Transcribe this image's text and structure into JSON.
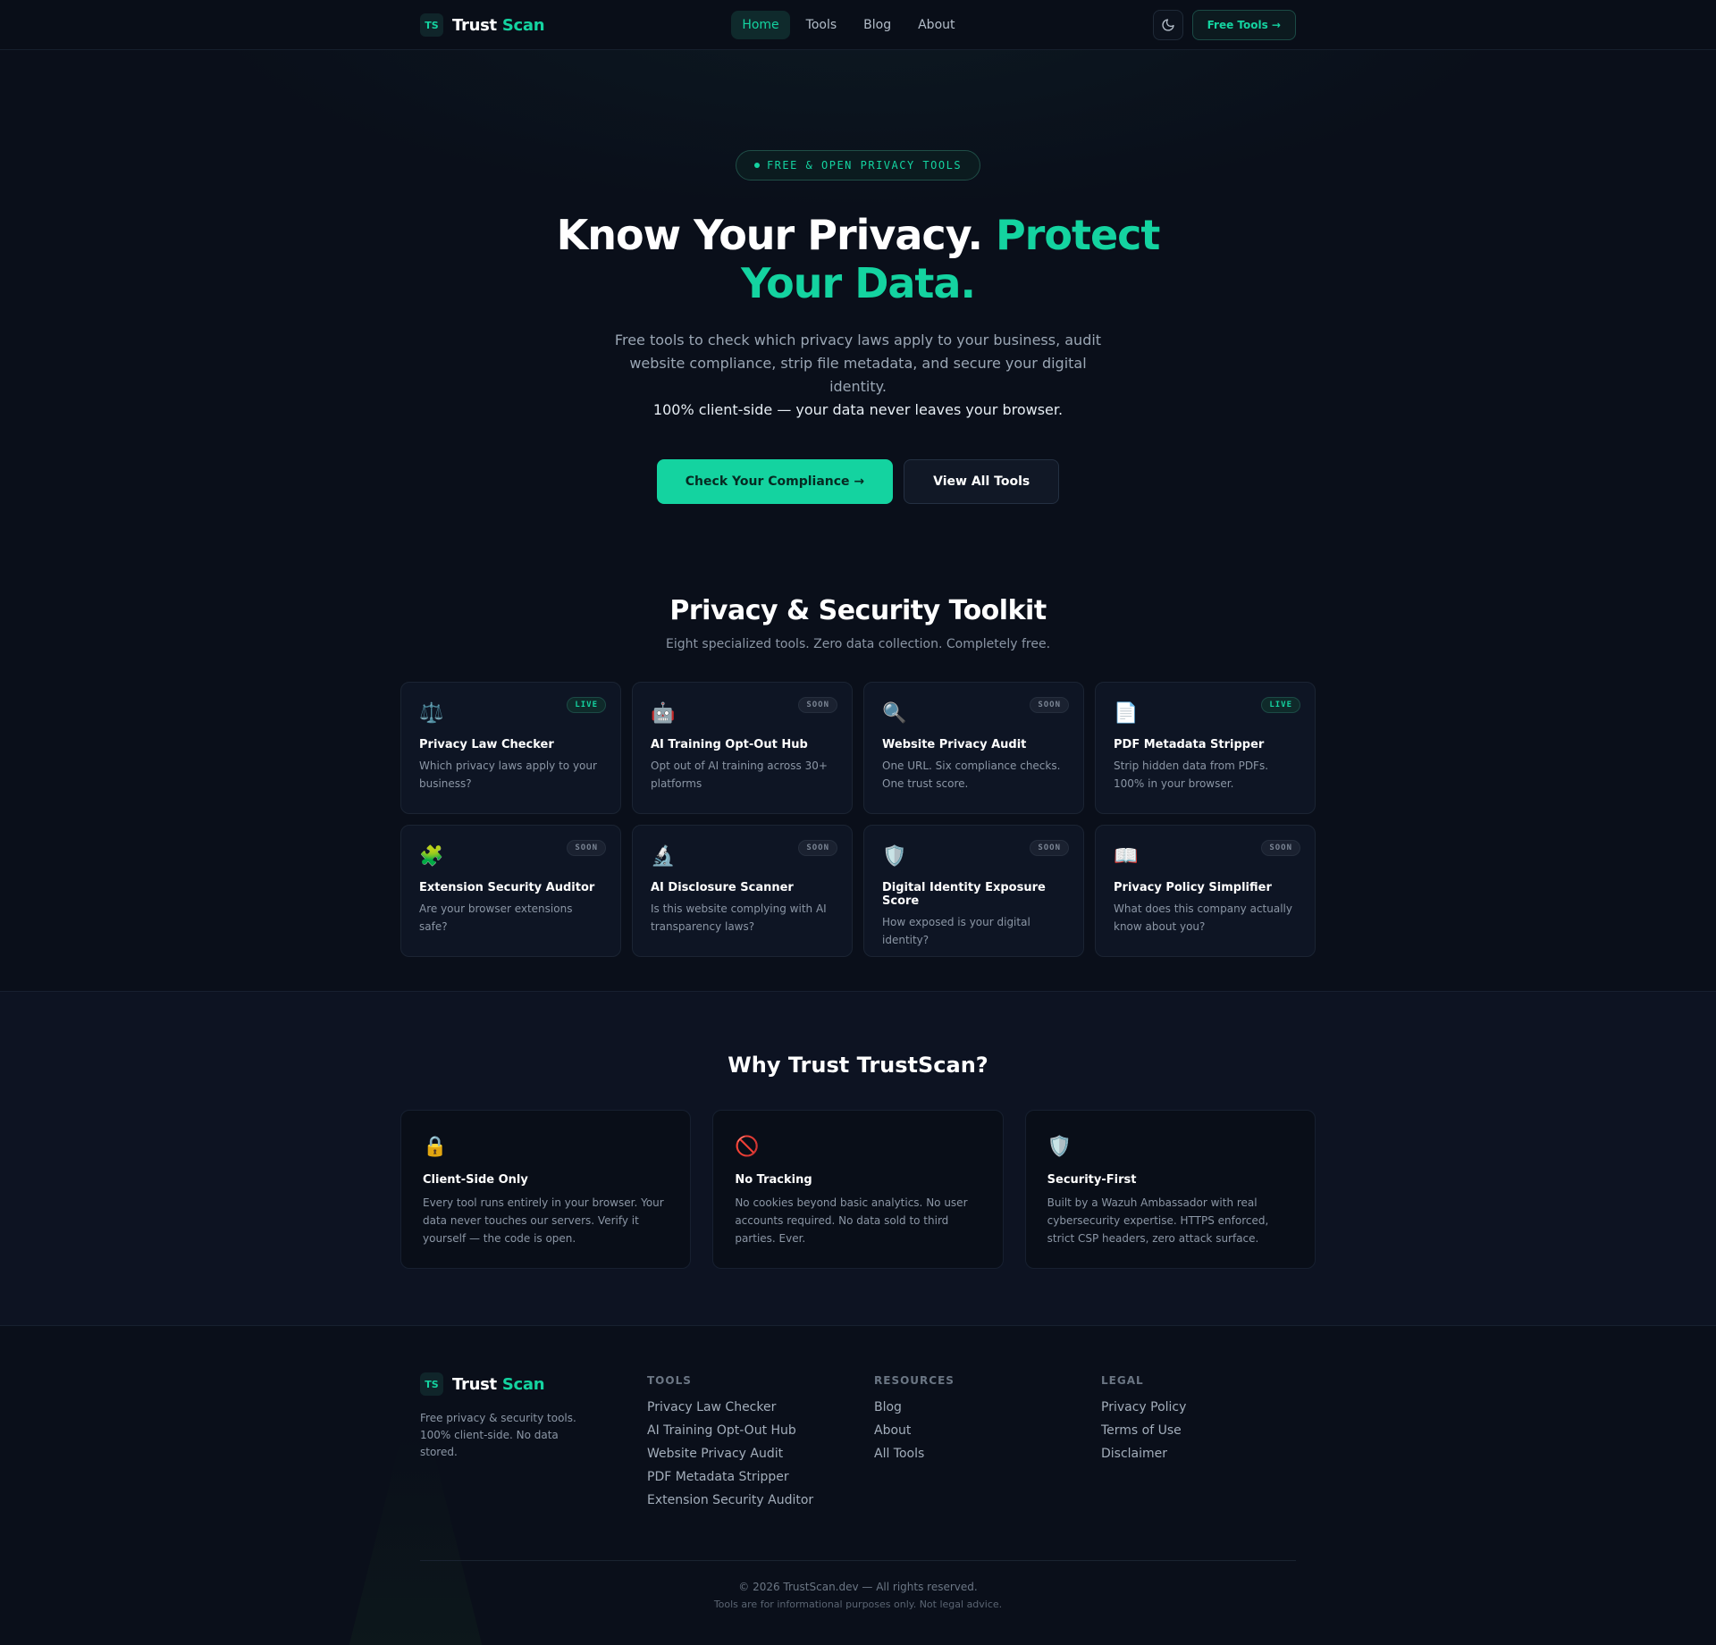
{
  "brand": {
    "badge": "TS",
    "word1": "Trust",
    "word2": "Scan"
  },
  "nav": {
    "links": [
      "Home",
      "Tools",
      "Blog",
      "About"
    ],
    "active": "Home",
    "theme_icon": "moon-icon",
    "cta": "Free Tools →"
  },
  "hero": {
    "pill": "FREE & OPEN PRIVACY TOOLS",
    "title_white": "Know Your Privacy.",
    "title_green": "Protect Your Data.",
    "subtitle": "Free tools to check which privacy laws apply to your business, audit website compliance, strip file metadata, and secure your digital identity.",
    "subtitle_strong": "100% client-side — your data never leaves your browser.",
    "primary_cta": "Check Your Compliance →",
    "secondary_cta": "View All Tools"
  },
  "toolkit": {
    "title": "Privacy & Security Toolkit",
    "subtitle": "Eight specialized tools. Zero data collection. Completely free.",
    "tools": [
      {
        "icon": "⚖️",
        "icon_name": "scales-icon",
        "badge": "LIVE",
        "title": "Privacy Law Checker",
        "desc": "Which privacy laws apply to your business?"
      },
      {
        "icon": "🤖",
        "icon_name": "robot-icon",
        "badge": "SOON",
        "title": "AI Training Opt-Out Hub",
        "desc": "Opt out of AI training across 30+ platforms"
      },
      {
        "icon": "🔍",
        "icon_name": "magnifier-icon",
        "badge": "SOON",
        "title": "Website Privacy Audit",
        "desc": "One URL. Six compliance checks. One trust score."
      },
      {
        "icon": "📄",
        "icon_name": "document-icon",
        "badge": "LIVE",
        "title": "PDF Metadata Stripper",
        "desc": "Strip hidden data from PDFs. 100% in your browser."
      },
      {
        "icon": "🧩",
        "icon_name": "puzzle-icon",
        "badge": "SOON",
        "title": "Extension Security Auditor",
        "desc": "Are your browser extensions safe?"
      },
      {
        "icon": "🔬",
        "icon_name": "microscope-icon",
        "badge": "SOON",
        "title": "AI Disclosure Scanner",
        "desc": "Is this website complying with AI transparency laws?"
      },
      {
        "icon": "🛡️",
        "icon_name": "shield-icon",
        "badge": "SOON",
        "title": "Digital Identity Exposure Score",
        "desc": "How exposed is your digital identity?"
      },
      {
        "icon": "📖",
        "icon_name": "book-icon",
        "badge": "SOON",
        "title": "Privacy Policy Simplifier",
        "desc": "What does this company actually know about you?"
      }
    ]
  },
  "why": {
    "title": "Why Trust TrustScan?",
    "items": [
      {
        "icon": "🔒",
        "icon_name": "lock-icon",
        "title": "Client-Side Only",
        "desc": "Every tool runs entirely in your browser. Your data never touches our servers. Verify it yourself — the code is open."
      },
      {
        "icon": "🚫",
        "icon_name": "no-entry-icon",
        "title": "No Tracking",
        "desc": "No cookies beyond basic analytics. No user accounts required. No data sold to third parties. Ever."
      },
      {
        "icon": "🛡️",
        "icon_name": "shield-icon",
        "title": "Security-First",
        "desc": "Built by a Wazuh Ambassador with real cybersecurity expertise. HTTPS enforced, strict CSP headers, zero attack surface."
      }
    ]
  },
  "footer": {
    "tagline": "Free privacy & security tools. 100% client-side. No data stored.",
    "columns": [
      {
        "heading": "TOOLS",
        "links": [
          "Privacy Law Checker",
          "AI Training Opt-Out Hub",
          "Website Privacy Audit",
          "PDF Metadata Stripper",
          "Extension Security Auditor"
        ]
      },
      {
        "heading": "RESOURCES",
        "links": [
          "Blog",
          "About",
          "All Tools"
        ]
      },
      {
        "heading": "LEGAL",
        "links": [
          "Privacy Policy",
          "Terms of Use",
          "Disclaimer"
        ]
      }
    ],
    "copyright": "© 2026 TrustScan.dev — All rights reserved.",
    "disclaimer": "Tools are for informational purposes only. Not legal advice."
  },
  "colors": {
    "accent": "#14d3a0",
    "background": "#0a0f1a",
    "card": "#0e1524"
  }
}
